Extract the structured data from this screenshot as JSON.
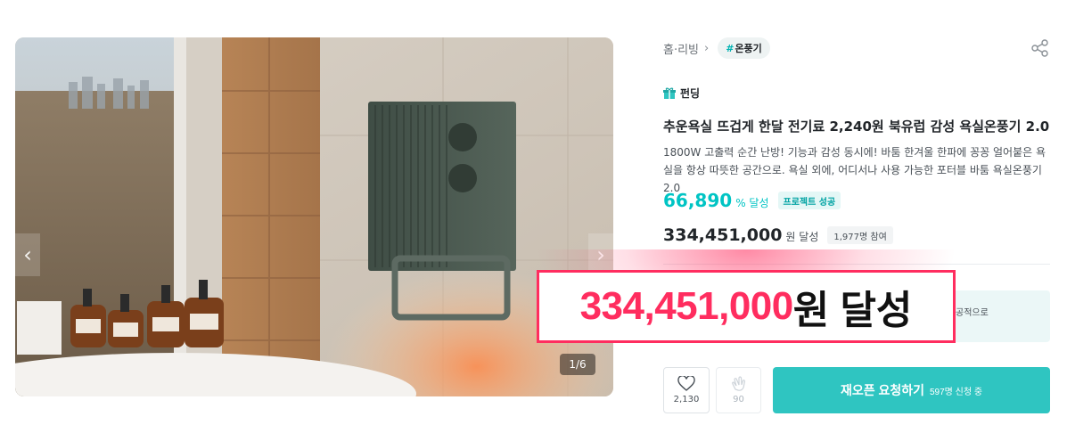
{
  "gallery": {
    "counter": "1/6",
    "prev_icon": "chevron-left-icon",
    "next_icon": "chevron-right-icon"
  },
  "breadcrumb": {
    "category": "홈·리빙",
    "tag_hash": "#",
    "tag_label": "온풍기"
  },
  "share_icon": "share-icon",
  "project": {
    "type_label": "펀딩",
    "title": "추운욕실 뜨겁게 한달 전기료 2,240원 북유럽 감성 욕실온풍기 2.0",
    "description": "1800W 고출력 순간 난방! 기능과 감성 동시에! 바툼 한겨울 한파에 꽁꽁 얼어붙은 욕실을 항상 따뜻한 공간으로. 욕실 외에, 어디서나 사용 가능한 포터블 바툼 욕실온풍기 2.0",
    "rate_value": "66,890",
    "rate_unit": "% 달성",
    "success_badge": "프로젝트 성공",
    "amount_value": "334,451,000",
    "amount_unit": "원 달성",
    "participants": "1,977명 참여"
  },
  "notice": {
    "text": "공적으로"
  },
  "actions": {
    "like_count": "2,130",
    "cheer_count": "90",
    "reopen_label": "재오픈 요청하기",
    "reopen_sub": "597명 신청 중"
  },
  "callout": {
    "number": "334,451,000",
    "suffix": "원 달성"
  },
  "colors": {
    "accent": "#00c4c4",
    "button": "#2fc5c1",
    "callout": "#ff2d5f"
  }
}
